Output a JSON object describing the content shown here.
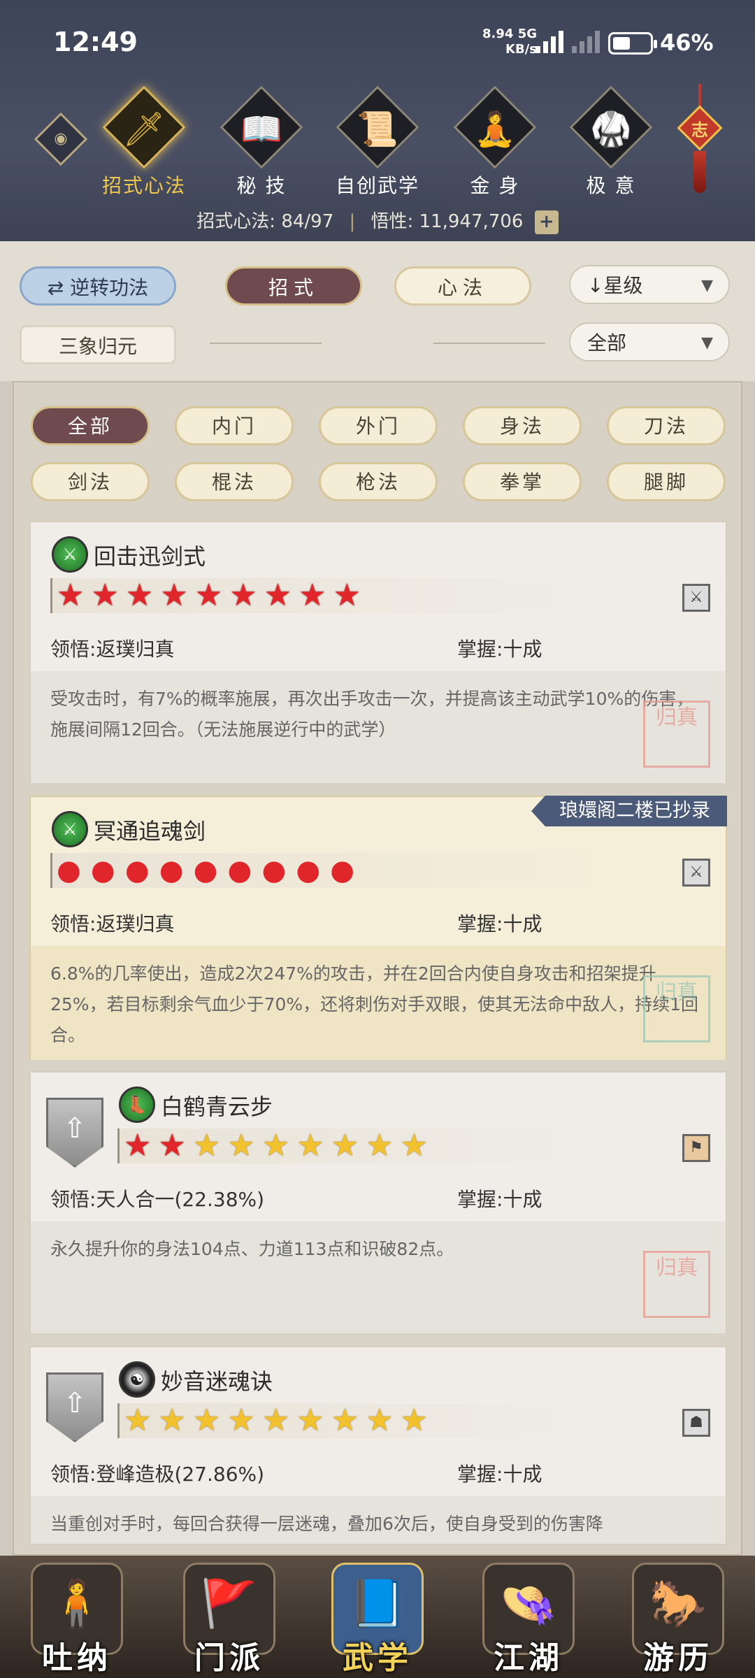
{
  "status": {
    "time": "12:49",
    "net_speed": "8.94",
    "net_unit": "KB/s",
    "network": "5G",
    "battery": "46%"
  },
  "top_tabs": [
    {
      "label": "招式心法",
      "icon": "sword-icon",
      "active": true
    },
    {
      "label": "秘 技",
      "icon": "book-icon",
      "active": false
    },
    {
      "label": "自创武学",
      "icon": "scroll-icon",
      "active": false
    },
    {
      "label": "金 身",
      "icon": "meditation-icon",
      "active": false
    },
    {
      "label": "极 意",
      "icon": "martial-stance-icon",
      "active": false
    }
  ],
  "knot_label": "志",
  "stats": {
    "moves_label": "招式心法:",
    "moves_value": "84/97",
    "insight_label": "悟性:",
    "insight_value": "11,947,706",
    "plus": "+"
  },
  "filters": {
    "reverse_button": "逆转功法",
    "moves_tab": "招式",
    "mind_tab": "心法",
    "sort_dropdown": "星级",
    "sanxiang_button": "三象归元",
    "scope_dropdown": "全部"
  },
  "categories": [
    "全部",
    "内门",
    "外门",
    "身法",
    "刀法",
    "剑法",
    "棍法",
    "枪法",
    "拳掌",
    "腿脚"
  ],
  "cards": [
    {
      "name": "回击迅剑式",
      "stars_red": 9,
      "stars_yellow": 0,
      "star_type": "star",
      "insight_label": "领悟:",
      "insight": "返璞归真",
      "mastery_label": "掌握:",
      "mastery": "十成",
      "desc": "受攻击时，有7%的概率施展，再次出手攻击一次，并提高该主动武学10%的伤害，施展间隔12回合。（无法施展逆行中的武学）",
      "ribbon": "",
      "tag_icon": "sword-tag-icon"
    },
    {
      "name": "冥通追魂剑",
      "stars_red": 9,
      "stars_yellow": 0,
      "star_type": "flame",
      "insight_label": "领悟:",
      "insight": "返璞归真",
      "mastery_label": "掌握:",
      "mastery": "十成",
      "desc": "6.8%的几率使出，造成2次247%的攻击，并在2回合内使自身攻击和招架提升25%，若目标剩余气血少于70%，还将刺伤对手双眼，使其无法命中敌人，持续1回合。",
      "ribbon": "琅嬛阁二楼已抄录",
      "tag_icon": "sword-tag-icon"
    },
    {
      "name": "白鹤青云步",
      "stars_red": 2,
      "stars_yellow": 7,
      "star_type": "star",
      "insight_label": "领悟:",
      "insight": "天人合一(22.38%)",
      "mastery_label": "掌握:",
      "mastery": "十成",
      "desc": "永久提升你的身法104点、力道113点和识破82点。",
      "ribbon": "",
      "tag_icon": "boot-tag-icon"
    },
    {
      "name": "妙音迷魂诀",
      "stars_red": 0,
      "stars_yellow": 9,
      "star_type": "star",
      "insight_label": "领悟:",
      "insight": "登峰造极(27.86%)",
      "mastery_label": "掌握:",
      "mastery": "十成",
      "desc": "当重创对手时，每回合获得一层迷魂，叠加6次后，使自身受到的伤害降",
      "ribbon": "",
      "tag_icon": "mask-tag-icon"
    }
  ],
  "seal_text": "归真",
  "bottom_nav": [
    {
      "label": "吐纳",
      "icon": "monk-icon",
      "active": false
    },
    {
      "label": "门派",
      "icon": "banner-icon",
      "active": false
    },
    {
      "label": "武学",
      "icon": "manual-icon",
      "active": true
    },
    {
      "label": "江湖",
      "icon": "straw-hat-icon",
      "active": false
    },
    {
      "label": "游历",
      "icon": "horse-icon",
      "active": false
    }
  ]
}
